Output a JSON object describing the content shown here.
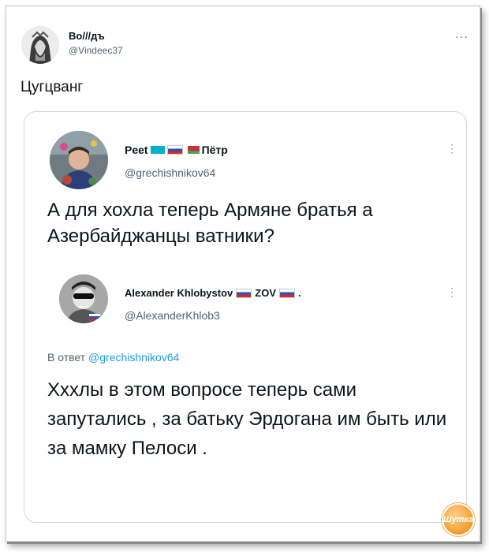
{
  "tweet": {
    "author_name": "Во///дъ",
    "author_handle": "@Vindeec37",
    "text": "Цугцванг",
    "more_icon": "more-horizontal-icon"
  },
  "quote1": {
    "author_name_part1": "Peet",
    "author_name_part2": "Пётр",
    "author_handle": "@grechishnikov64",
    "text": "А для хохла теперь Армяне братья а Азербайджанцы ватники?"
  },
  "quote2": {
    "author_name_part1": "Alexander Khlobystov",
    "author_name_part2": "ZOV",
    "author_name_part3": ".",
    "author_handle": "@AlexanderKhlob3",
    "reply_prefix": "В ответ",
    "reply_to": "@grechishnikov64",
    "text": "Хххлы в этом вопросе теперь сами запутались , за батьку Эрдогана им быть или за мамку Пелоси ."
  },
  "watermark": {
    "text": "Шутка"
  },
  "colors": {
    "link": "#1d9bf0",
    "secondary_text": "#536471",
    "border": "#cfd9de"
  }
}
